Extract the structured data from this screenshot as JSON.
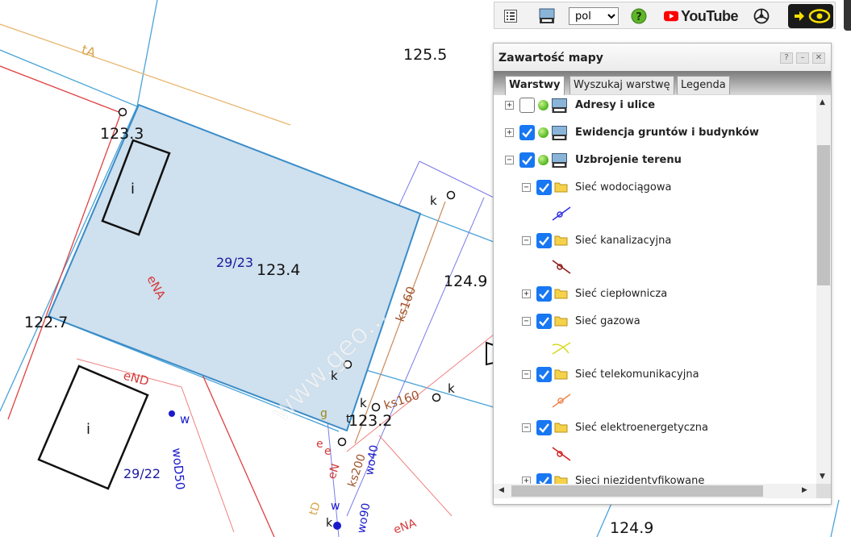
{
  "map": {
    "heights": [
      "125.5",
      "123.3",
      "123.4",
      "124.9",
      "122.7",
      "123.2",
      "124.9"
    ],
    "parcels": [
      "29/23",
      "29/22"
    ],
    "building_marks": [
      "i",
      "i"
    ],
    "line_labels": [
      "tA",
      "eNA",
      "eND",
      "woD50",
      "ks160",
      "ks160",
      "ks200",
      "wo40",
      "wo90",
      "tD",
      "eN",
      "eNA"
    ],
    "point_labels": [
      "k",
      "k",
      "k",
      "k",
      "w",
      "g",
      "t",
      "e",
      "e",
      "w",
      "k"
    ],
    "watermark": "www.geo..."
  },
  "toolbar": {
    "lang_value": "pol",
    "lang_options": [
      "pol"
    ],
    "youtube_label": "YouTube",
    "icons": [
      "layers-grid-icon",
      "wms-icon",
      "help-icon",
      "youtube-icon",
      "steering-icon",
      "eye-icon"
    ]
  },
  "panel": {
    "title": "Zawartość mapy",
    "header_buttons": [
      "?",
      "–",
      "✕"
    ],
    "tabs": [
      {
        "label": "Warstwy",
        "active": true
      },
      {
        "label": "Wyszukaj warstwę",
        "active": false
      },
      {
        "label": "Legenda",
        "active": false
      }
    ],
    "layers": [
      {
        "label": "Adresy i ulice",
        "checked": false,
        "expander": "+"
      },
      {
        "label": "Ewidencja gruntów i budynków",
        "checked": true,
        "expander": "+"
      },
      {
        "label": "Uzbrojenie terenu",
        "checked": true,
        "expander": "−"
      },
      {
        "label": "Sieć wodociągowa",
        "checked": true,
        "expander": "−",
        "legend_color": "#2e2ee6"
      },
      {
        "label": "Sieć kanalizacyjna",
        "checked": true,
        "expander": "−",
        "legend_color": "#8b1a1a"
      },
      {
        "label": "Sieć ciepłownicza",
        "checked": true,
        "expander": "+"
      },
      {
        "label": "Sieć gazowa",
        "checked": true,
        "expander": "−",
        "legend_color": "#d8d820"
      },
      {
        "label": "Sieć telekomunikacyjna",
        "checked": true,
        "expander": "−",
        "legend_color": "#f08850"
      },
      {
        "label": "Sieć elektroenergetyczna",
        "checked": true,
        "expander": "−",
        "legend_color": "#d42020"
      },
      {
        "label": "Sieci niezidentyfikowane",
        "checked": true,
        "expander": "+"
      }
    ]
  },
  "colors": {
    "checkbox": "#1877f2",
    "parcel_fill": "#cfe0ee",
    "parcel_stroke": "#3a8cc8",
    "youtube_red": "#ff0000",
    "eye_yellow": "#f5e000"
  }
}
